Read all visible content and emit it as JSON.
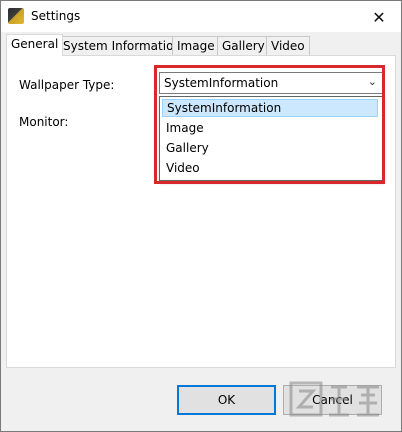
{
  "window": {
    "title": "Settings",
    "close_glyph": "✕"
  },
  "tabs": [
    {
      "label": "General",
      "active": true
    },
    {
      "label": "System Information",
      "active": false
    },
    {
      "label": "Image",
      "active": false
    },
    {
      "label": "Gallery",
      "active": false
    },
    {
      "label": "Video",
      "active": false
    }
  ],
  "general": {
    "wallpaper_type_label": "Wallpaper Type:",
    "monitor_label": "Monitor:",
    "wallpaper_type_value": "SystemInformation",
    "dropdown_arrow": "⌄",
    "options": [
      "SystemInformation",
      "Image",
      "Gallery",
      "Video"
    ],
    "selected_option": "SystemInformation"
  },
  "buttons": {
    "ok_label": "OK",
    "cancel_label": "Cancel"
  },
  "colors": {
    "highlight_border": "#d6282d",
    "selection_bg": "#cce8ff",
    "default_button_border": "#0078d7"
  }
}
